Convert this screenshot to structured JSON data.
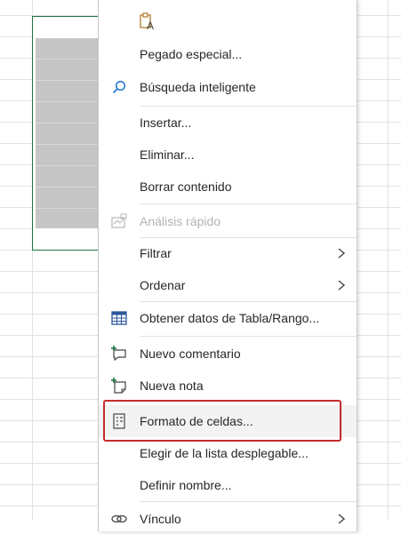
{
  "menu": {
    "items": [
      {
        "id": "paste-icon-row",
        "label": "",
        "icon": "paste-text-icon"
      },
      {
        "id": "paste-special",
        "label": "Pegado especial..."
      },
      {
        "id": "smart-lookup",
        "label": "Búsqueda inteligente",
        "icon": "search-icon"
      },
      {
        "id": "insert",
        "label": "Insertar..."
      },
      {
        "id": "delete",
        "label": "Eliminar..."
      },
      {
        "id": "clear-contents",
        "label": "Borrar contenido"
      },
      {
        "id": "quick-analysis",
        "label": "Análisis rápido",
        "icon": "quick-analysis-icon",
        "disabled": true
      },
      {
        "id": "filter",
        "label": "Filtrar",
        "submenu": true
      },
      {
        "id": "sort",
        "label": "Ordenar",
        "submenu": true
      },
      {
        "id": "get-data",
        "label": "Obtener datos de Tabla/Rango...",
        "icon": "table-icon"
      },
      {
        "id": "new-comment",
        "label": "Nuevo comentario",
        "icon": "comment-icon"
      },
      {
        "id": "new-note",
        "label": "Nueva nota",
        "icon": "note-icon"
      },
      {
        "id": "format-cells",
        "label": "Formato de celdas...",
        "icon": "format-cells-icon",
        "highlighted": true
      },
      {
        "id": "pick-list",
        "label": "Elegir de la lista desplegable..."
      },
      {
        "id": "define-name",
        "label": "Definir nombre..."
      },
      {
        "id": "link",
        "label": "Vínculo",
        "icon": "link-icon",
        "submenu": true
      }
    ]
  },
  "colors": {
    "selection_border": "#217346",
    "highlight_border": "#c42b2b",
    "icon_blue": "#2b579a",
    "icon_green": "#217346"
  }
}
